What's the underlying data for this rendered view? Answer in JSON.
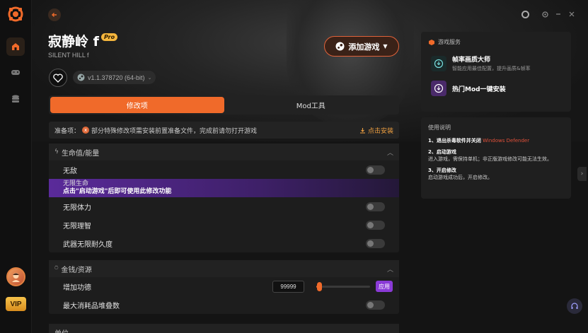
{
  "sidebar": {
    "items": [
      {
        "icon": "home-icon",
        "active": true
      },
      {
        "icon": "gamepad-icon",
        "active": false
      },
      {
        "icon": "database-icon",
        "active": false
      }
    ],
    "vip_label": "VIP"
  },
  "header": {
    "title": "寂静岭 f",
    "pro_badge": "Pro",
    "subtitle": "SILENT HILL f",
    "version": "v1.1.378720 (64-bit)",
    "add_game_label": "添加游戏"
  },
  "tabs": [
    {
      "label": "修改项",
      "active": true
    },
    {
      "label": "Mod工具",
      "active": false
    }
  ],
  "prep": {
    "label": "准备项：",
    "warn_icon": "x",
    "text": "部分特殊修改项需安装前置准备文件，完成前请勿打开游戏",
    "install_label": "点击安装"
  },
  "sections": [
    {
      "title": "生命值/能量",
      "rows": [
        {
          "label": "无敌"
        },
        {
          "label": "无限生命",
          "hint": "点击\"启动游戏\"后即可使用此修改功能"
        },
        {
          "label": "无限体力"
        },
        {
          "label": "无限理智"
        },
        {
          "label": "武器无限耐久度"
        }
      ]
    },
    {
      "title": "金钱/资源",
      "rows": [
        {
          "label": "增加功德",
          "value": "99999",
          "apply": "应用",
          "slider": 0.05
        },
        {
          "label": "最大消耗品堆叠数"
        }
      ]
    },
    {
      "title": "单位"
    }
  ],
  "services": {
    "title": "游戏服务",
    "items": [
      {
        "name": "帧率画质大师",
        "desc": "智能应用最佳配置，提升画质&帧率"
      },
      {
        "name": "热门Mod一键安装",
        "desc": ""
      }
    ]
  },
  "guide": {
    "title": "使用说明",
    "steps": [
      {
        "head": "1、退出杀毒软件并关闭",
        "red": "Windows Defender",
        "body": ""
      },
      {
        "head": "2、启动游戏",
        "body": "进入游戏，需保持单机；非正版游戏修改可能无法生效。"
      },
      {
        "head": "3、开启修改",
        "body": "启动游戏成功后，开启修改。"
      }
    ]
  },
  "colors": {
    "accent": "#f06a2a",
    "purple": "#8a3ad6",
    "bg": "#141414"
  }
}
